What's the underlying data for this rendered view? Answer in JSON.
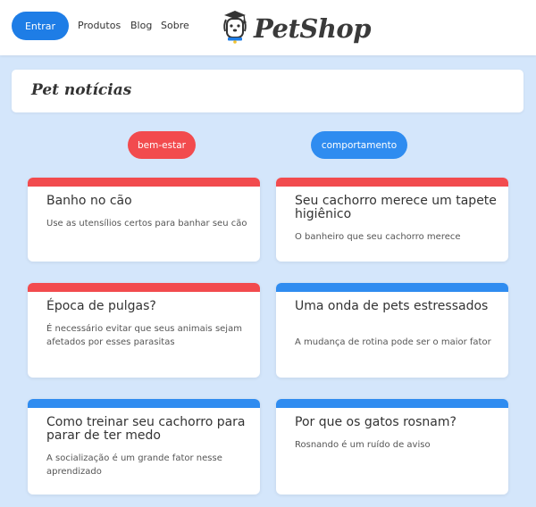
{
  "header": {
    "login_label": "Entrar",
    "nav": [
      "Produtos",
      "Blog",
      "Sobre"
    ],
    "logo_text": "PetShop",
    "logo_icon": "dog-mascot-icon"
  },
  "section": {
    "title": "Pet notícias"
  },
  "categories": [
    {
      "label": "bem-estar",
      "color": "#f24b4e"
    },
    {
      "label": "comportamento",
      "color": "#2f8cf0"
    }
  ],
  "colors": {
    "primary": "#1e7de6",
    "background": "#d4e6fb",
    "red": "#f24b4e",
    "blue": "#2f8cf0"
  },
  "articles": [
    {
      "title": "Banho no cão",
      "summary": "Use as utensílios certos para banhar seu cão",
      "category": "bem-estar"
    },
    {
      "title": "Seu cachorro merece um tapete higiênico",
      "summary": "O banheiro que seu cachorro merece",
      "category": "bem-estar"
    },
    {
      "title": "Época de pulgas?",
      "summary": "É necessário evitar que seus animais sejam afetados por esses parasitas",
      "category": "bem-estar"
    },
    {
      "title": "Uma onda de pets estressados",
      "summary": "A mudança de rotina pode ser o maior fator",
      "category": "comportamento"
    },
    {
      "title": "Como treinar seu cachorro para parar de ter medo",
      "summary": "A socialização é um grande fator nesse aprendizado",
      "category": "comportamento"
    },
    {
      "title": "Por que os gatos rosnam?",
      "summary": "Rosnando é um ruído de aviso",
      "category": "comportamento"
    }
  ]
}
